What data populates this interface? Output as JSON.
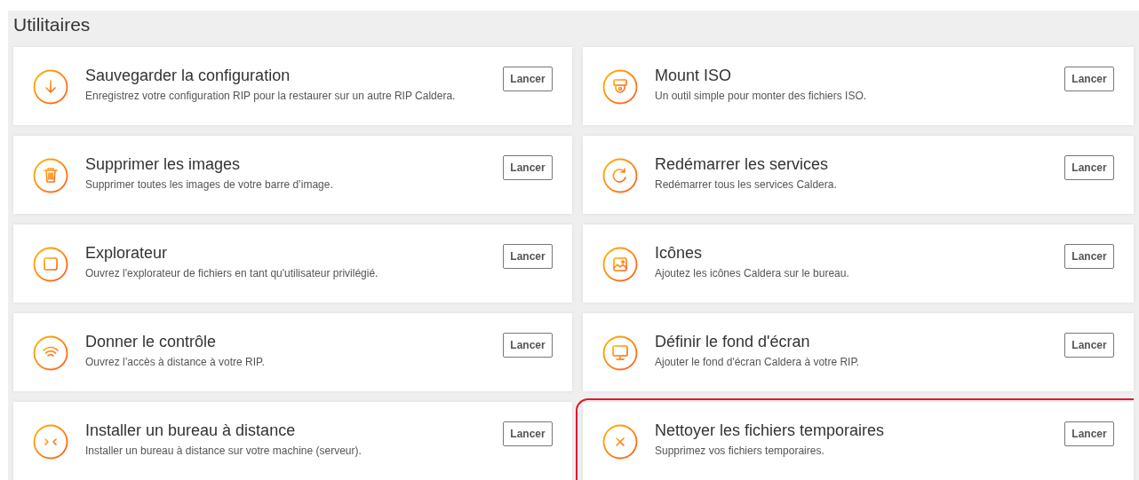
{
  "section": {
    "title": "Utilitaires"
  },
  "tools": [
    {
      "title": "Sauvegarder la configuration",
      "description": "Enregistrez votre configuration RIP pour la restaurer sur un autre RIP Caldera.",
      "button": "Lancer",
      "highlighted": false
    },
    {
      "title": "Mount ISO",
      "description": "Un outil simple pour monter des fichiers ISO.",
      "button": "Lancer",
      "highlighted": false
    },
    {
      "title": "Supprimer les images",
      "description": "Supprimer toutes les images de votre barre d’image.",
      "button": "Lancer",
      "highlighted": false
    },
    {
      "title": "Redémarrer les services",
      "description": "Redémarrer tous les services Caldera.",
      "button": "Lancer",
      "highlighted": false
    },
    {
      "title": "Explorateur",
      "description": "Ouvrez l'explorateur de fichiers en tant qu'utilisateur privilégié.",
      "button": "Lancer",
      "highlighted": false
    },
    {
      "title": "Icônes",
      "description": "Ajoutez les icônes Caldera sur le bureau.",
      "button": "Lancer",
      "highlighted": false
    },
    {
      "title": "Donner le contrôle",
      "description": "Ouvrez l’accès à distance à votre RIP.",
      "button": "Lancer",
      "highlighted": false
    },
    {
      "title": "Définir le fond d'écran",
      "description": "Ajouter le fond d'écran Caldera à votre RIP.",
      "button": "Lancer",
      "highlighted": false
    },
    {
      "title": "Installer un bureau à distance",
      "description": "Installer un bureau à distance sur votre machine (serveur).",
      "button": "Lancer",
      "highlighted": false
    },
    {
      "title": "Nettoyer les fichiers temporaires",
      "description": "Supprimez vos fichiers temporaires.",
      "button": "Lancer",
      "highlighted": true
    }
  ]
}
